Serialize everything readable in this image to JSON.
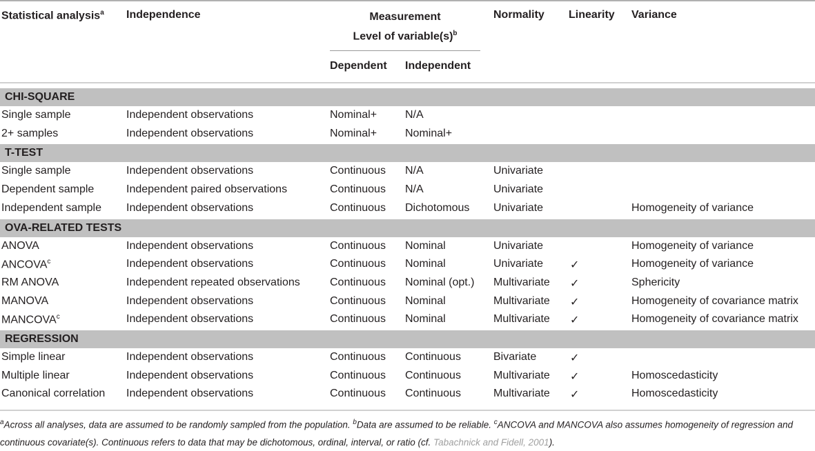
{
  "header": {
    "analysis": "Statistical analysis",
    "analysis_sup": "a",
    "independence": "Independence",
    "measurement_top": "Measurement",
    "measurement_bottom": "Level of variable(s)",
    "measurement_sup": "b",
    "dependent": "Dependent",
    "independent": "Independent",
    "normality": "Normality",
    "linearity": "Linearity",
    "variance": "Variance"
  },
  "sections": [
    {
      "title": "CHI-SQUARE",
      "rows": [
        {
          "analysis": "Single sample",
          "sup": "",
          "independence": "Independent observations",
          "dependent": "Nominal+",
          "independent": "N/A",
          "normality": "",
          "linearity": "",
          "variance": ""
        },
        {
          "analysis": "2+ samples",
          "sup": "",
          "independence": "Independent observations",
          "dependent": "Nominal+",
          "independent": "Nominal+",
          "normality": "",
          "linearity": "",
          "variance": ""
        }
      ]
    },
    {
      "title": "T-TEST",
      "rows": [
        {
          "analysis": "Single sample",
          "sup": "",
          "independence": "Independent observations",
          "dependent": "Continuous",
          "independent": "N/A",
          "normality": "Univariate",
          "linearity": "",
          "variance": ""
        },
        {
          "analysis": "Dependent sample",
          "sup": "",
          "independence": "Independent paired observations",
          "dependent": "Continuous",
          "independent": "N/A",
          "normality": "Univariate",
          "linearity": "",
          "variance": ""
        },
        {
          "analysis": "Independent sample",
          "sup": "",
          "independence": "Independent observations",
          "dependent": "Continuous",
          "independent": "Dichotomous",
          "normality": "Univariate",
          "linearity": "",
          "variance": "Homogeneity of variance"
        }
      ]
    },
    {
      "title": "OVA-RELATED TESTS",
      "rows": [
        {
          "analysis": "ANOVA",
          "sup": "",
          "independence": "Independent observations",
          "dependent": "Continuous",
          "independent": "Nominal",
          "normality": "Univariate",
          "linearity": "",
          "variance": "Homogeneity of variance"
        },
        {
          "analysis": "ANCOVA",
          "sup": "c",
          "independence": "Independent observations",
          "dependent": "Continuous",
          "independent": "Nominal",
          "normality": "Univariate",
          "linearity": "✓",
          "variance": "Homogeneity of variance"
        },
        {
          "analysis": "RM ANOVA",
          "sup": "",
          "independence": "Independent repeated observations",
          "dependent": "Continuous",
          "independent": "Nominal (opt.)",
          "normality": "Multivariate",
          "linearity": "✓",
          "variance": "Sphericity"
        },
        {
          "analysis": "MANOVA",
          "sup": "",
          "independence": "Independent observations",
          "dependent": "Continuous",
          "independent": "Nominal",
          "normality": "Multivariate",
          "linearity": "✓",
          "variance": "Homogeneity of covariance matrix"
        },
        {
          "analysis": "MANCOVA",
          "sup": "c",
          "independence": "Independent observations",
          "dependent": "Continuous",
          "independent": "Nominal",
          "normality": "Multivariate",
          "linearity": "✓",
          "variance": "Homogeneity of covariance matrix"
        }
      ]
    },
    {
      "title": "REGRESSION",
      "rows": [
        {
          "analysis": "Simple linear",
          "sup": "",
          "independence": "Independent observations",
          "dependent": "Continuous",
          "independent": "Continuous",
          "normality": "Bivariate",
          "linearity": "✓",
          "variance": ""
        },
        {
          "analysis": "Multiple linear",
          "sup": "",
          "independence": "Independent observations",
          "dependent": "Continuous",
          "independent": "Continuous",
          "normality": "Multivariate",
          "linearity": "✓",
          "variance": "Homoscedasticity"
        },
        {
          "analysis": "Canonical correlation",
          "sup": "",
          "independence": "Independent observations",
          "dependent": "Continuous",
          "independent": "Continuous",
          "normality": "Multivariate",
          "linearity": "✓",
          "variance": "Homoscedasticity"
        }
      ]
    }
  ],
  "footnote": {
    "a_mark": "a",
    "a_text": "Across all analyses, data are assumed to be randomly sampled from the population. ",
    "b_mark": "b",
    "b_text": "Data are assumed to be reliable. ",
    "c_mark": "c",
    "c_text": "ANCOVA and MANCOVA also assumes homogeneity of regression and continuous covariate(s). Continuous refers to data that may be dichotomous, ordinal, interval, or ratio (cf. ",
    "citation": "Tabachnick and Fidell, 2001",
    "end": ")."
  }
}
